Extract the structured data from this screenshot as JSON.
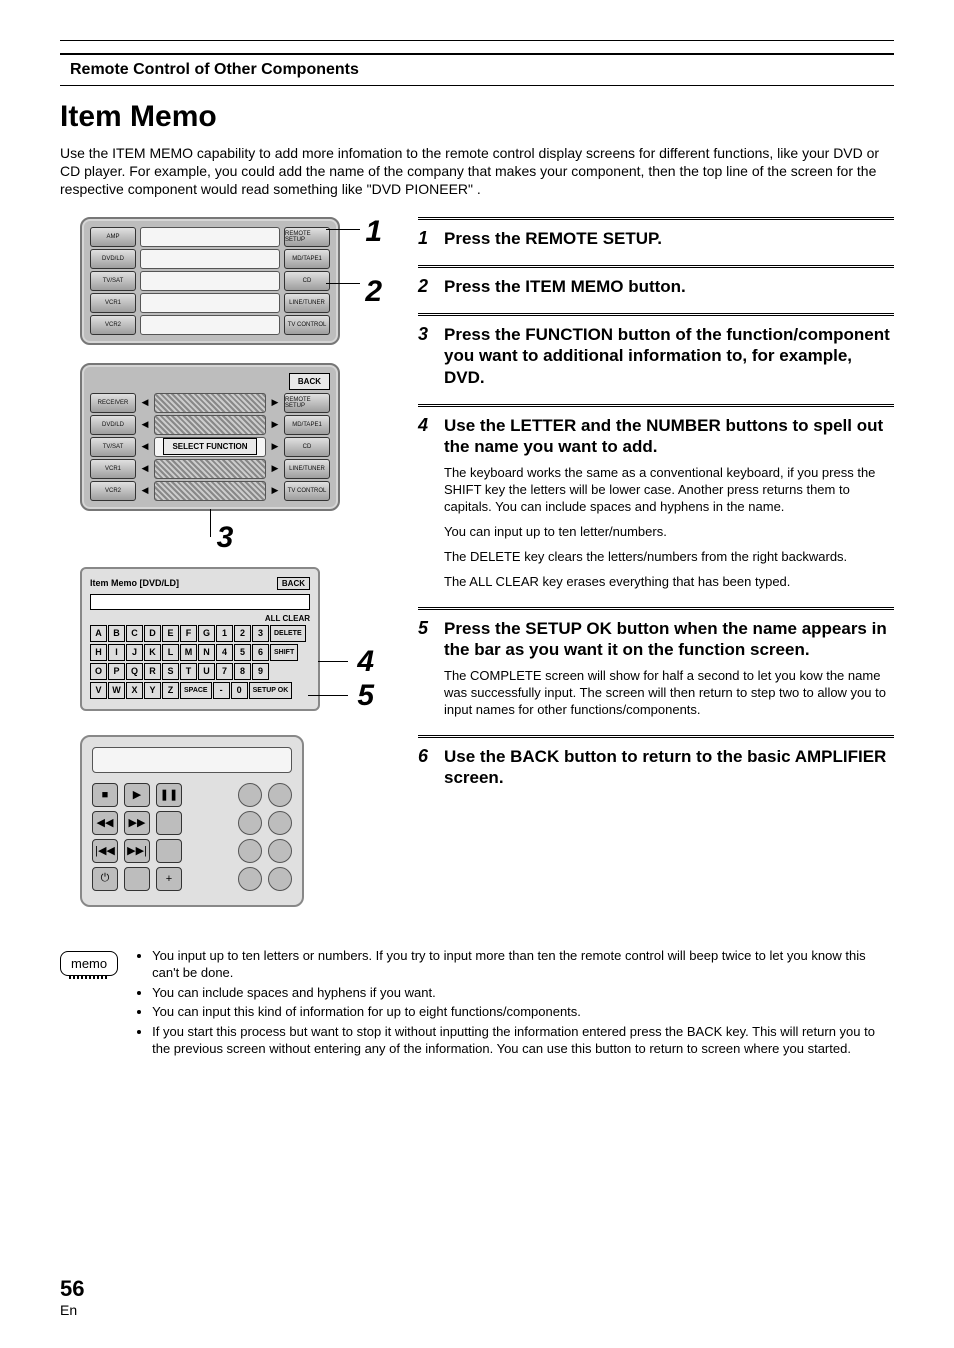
{
  "header": {
    "section": "Remote Control of Other Components"
  },
  "title": "Item Memo",
  "intro": "Use the ITEM MEMO capability to add more infomation to the remote control display screens for different functions, like your DVD or CD player. For example, you could add the name of the company that makes your component, then the top line of the screen for the respective component would read something like \"DVD PIONEER\" .",
  "left_figs": {
    "panel1": {
      "left": [
        "AMP",
        "DVD/LD",
        "TV/SAT",
        "VCR1",
        "VCR2"
      ],
      "right": [
        "REMOTE SETUP",
        "MD/TAPE1",
        "CD",
        "LINE/TUNER",
        "TV CONTROL"
      ]
    },
    "callouts": {
      "n1": "1",
      "n2": "2",
      "n3": "3",
      "n4": "4",
      "n5": "5"
    },
    "panel2": {
      "back": "BACK",
      "center": "SELECT FUNCTION",
      "left": [
        "RECEIVER",
        "DVD/LD",
        "TV/SAT",
        "VCR1",
        "VCR2"
      ],
      "right": [
        "REMOTE SETUP",
        "MD/TAPE1",
        "CD",
        "LINE/TUNER",
        "TV CONTROL"
      ]
    },
    "kb": {
      "title": "Item Memo  [DVD/LD]",
      "back": "BACK",
      "allclear": "ALL CLEAR",
      "rows": [
        [
          "A",
          "B",
          "C",
          "D",
          "E",
          "F",
          "G",
          "1",
          "2",
          "3",
          "DELETE"
        ],
        [
          "H",
          "I",
          "J",
          "K",
          "L",
          "M",
          "N",
          "4",
          "5",
          "6",
          "SHIFT"
        ],
        [
          "O",
          "P",
          "Q",
          "R",
          "S",
          "T",
          "U",
          "7",
          "8",
          "9",
          ""
        ],
        [
          "V",
          "W",
          "X",
          "Y",
          "Z",
          "SPACE",
          "-",
          "0",
          "SETUP OK"
        ]
      ]
    }
  },
  "steps": [
    {
      "n": "1",
      "title": "Press the REMOTE SETUP.",
      "body": []
    },
    {
      "n": "2",
      "title": "Press the ITEM MEMO button.",
      "body": []
    },
    {
      "n": "3",
      "title": "Press the FUNCTION button of the function/component you want to additional information to, for example, DVD.",
      "body": []
    },
    {
      "n": "4",
      "title": "Use the LETTER and the NUMBER buttons to spell out the name you want to add.",
      "body": [
        "The keyboard works the same as a conventional keyboard, if you press the SHIFT key the letters will be lower case. Another press returns them to capitals. You can include spaces and hyphens in the name.",
        "You can input up to ten letter/numbers.",
        "The DELETE key clears the letters/numbers from the right backwards.",
        "The ALL CLEAR key erases everything that has been typed."
      ]
    },
    {
      "n": "5",
      "title": "Press the SETUP OK button when the name appears in the bar as you want it on the function screen.",
      "body": [
        "The COMPLETE screen will show for half a second to let you kow the name was successfully input. The screen will then return to step two to allow you to input names for other functions/components."
      ]
    },
    {
      "n": "6",
      "title": "Use the BACK button to return to the basic AMPLIFIER screen.",
      "body": []
    }
  ],
  "memo": {
    "label": "memo",
    "items": [
      "You input up to ten letters or numbers. If you try to input more than ten the remote control will beep twice to let you know this can't be done.",
      "You can include spaces and hyphens if you want.",
      "You can input this kind of information for up to eight functions/components.",
      "If you start this process but want to stop it without inputting the information entered press the BACK key. This will return you to the previous screen without entering any of the information. You can use this button to return to screen where you started."
    ]
  },
  "footer": {
    "page": "56",
    "lang": "En"
  }
}
